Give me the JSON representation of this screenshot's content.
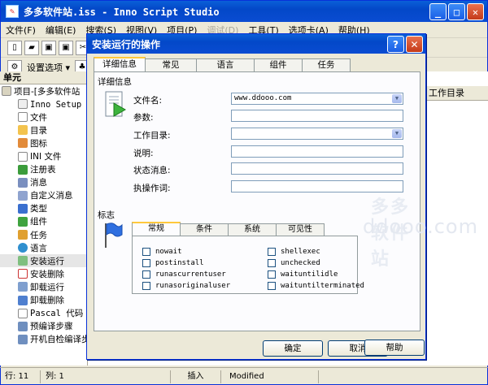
{
  "window": {
    "title": "多多软件站.iss - Inno Script Studio"
  },
  "menu": [
    "文件(F)",
    "编辑(E)",
    "搜索(S)",
    "视图(V)",
    "项目(P)",
    "调试(D)",
    "工具(T)",
    "选项卡(A)",
    "帮助(H)"
  ],
  "toolbar2": {
    "options_label": "设置选项 ▾"
  },
  "panel": {
    "title": "单元"
  },
  "tree": [
    "项目-[多多软件站",
    "Inno Setup 脚",
    "文件",
    "目录",
    "图标",
    "INI 文件",
    "注册表",
    "消息",
    "自定义消息",
    "类型",
    "组件",
    "任务",
    "语言",
    "安装运行",
    "安装删除",
    "卸载运行",
    "卸载删除",
    "Pascal 代码",
    "预编译步骤",
    "开机自检编译步"
  ],
  "rightpane": {
    "column": "工作目录"
  },
  "dialog": {
    "title": "安装运行的操作",
    "tabs": [
      "详细信息",
      "常见",
      "语言",
      "组件",
      "任务"
    ],
    "section_details": "详细信息",
    "fields": {
      "filename_label": "文件名:",
      "filename_value": "www.ddooo.com",
      "params_label": "参数:",
      "workdir_label": "工作目录:",
      "desc_label": "说明:",
      "status_label": "状态消息:",
      "verb_label": "执操作词:"
    },
    "section_flags": "标志",
    "subtabs": [
      "常规",
      "条件",
      "系统",
      "可见性"
    ],
    "flags_left": [
      "nowait",
      "postinstall",
      "runascurrentuser",
      "runasoriginaluser"
    ],
    "flags_right": [
      "shellexec",
      "unchecked",
      "waituntilidle",
      "waituntilterminated"
    ],
    "buttons": {
      "ok": "确定",
      "cancel": "取消",
      "help": "帮助"
    },
    "watermark": {
      "cn": "多多软件站",
      "en": "ddooo.com"
    }
  },
  "status": {
    "row": "行: 11",
    "col": "列: 1",
    "insert": "插入",
    "modified": "Modified"
  }
}
